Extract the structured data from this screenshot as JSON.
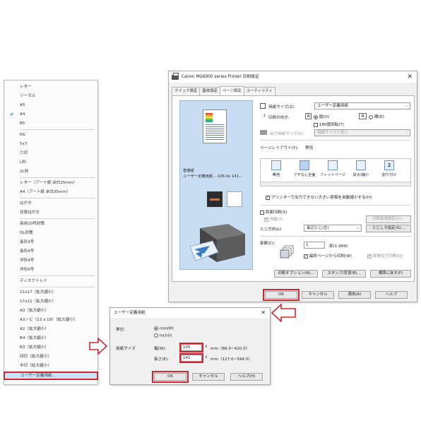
{
  "paper_list": {
    "items": [
      {
        "label": "レター",
        "checked": false
      },
      {
        "label": "リーガル",
        "checked": false
      },
      {
        "label": "A5",
        "checked": false
      },
      {
        "label": "A4",
        "checked": true
      },
      {
        "label": "B5",
        "checked": false
      },
      {
        "label": "KG",
        "checked": false
      },
      {
        "label": "5x7",
        "checked": false
      },
      {
        "label": "六切",
        "checked": false
      },
      {
        "label": "L判",
        "checked": false
      },
      {
        "label": "2L判",
        "checked": false
      },
      {
        "label": "レター（アート紙 余白35mm）",
        "checked": false
      },
      {
        "label": "A4（アート紙 余白35mm）",
        "checked": false
      },
      {
        "label": "はがき",
        "checked": false
      },
      {
        "label": "往復はがき",
        "checked": false
      },
      {
        "label": "商用10号封筒",
        "checked": false
      },
      {
        "label": "DL封筒",
        "checked": false
      },
      {
        "label": "長形3号",
        "checked": false
      },
      {
        "label": "長形4号",
        "checked": false
      },
      {
        "label": "洋形4号",
        "checked": false
      },
      {
        "label": "洋形6号",
        "checked": false
      },
      {
        "label": "ディスクトレイ",
        "checked": false
      },
      {
        "label": "11x17（拡大縮小）",
        "checked": false
      },
      {
        "label": "17x22（拡大縮小）",
        "checked": false
      },
      {
        "label": "A3（拡大縮小）",
        "checked": false
      },
      {
        "label": "A3ノビ（13 x 19）（拡大縮小）",
        "checked": false
      },
      {
        "label": "A2（拡大縮小）",
        "checked": false
      },
      {
        "label": "B4（拡大縮小）",
        "checked": false
      },
      {
        "label": "B3（拡大縮小）",
        "checked": false
      },
      {
        "label": "四切（拡大縮小）",
        "checked": false
      },
      {
        "label": "半切（拡大縮小）",
        "checked": false
      }
    ],
    "selected_item": "ユーザー定義用紙..."
  },
  "print_dialog": {
    "title": "Canon MG6900 series Printer 印刷設定",
    "close_glyph": "✕",
    "tabs": [
      {
        "label": "クイック設定",
        "active": false
      },
      {
        "label": "基本設定",
        "active": false
      },
      {
        "label": "ページ設定",
        "active": true
      },
      {
        "label": "ユーティリティ",
        "active": false
      }
    ],
    "preview": {
      "media_line1": "普通紙",
      "media_line2": "ユーザー定義用紙... 105.0x 141..."
    },
    "paper_size_label": "用紙サイズ(Z):",
    "paper_size_value": "ユーザー定義用紙",
    "orientation_label": "印刷の向き:",
    "orientation_portrait": "縦(O)",
    "orientation_landscape": "横(D)",
    "orientation_selected": "portrait",
    "rotate180_label": "180度回転(T)",
    "output_size_label": "出力用紙サイズ(E):",
    "output_size_value": "用紙サイズと同じ",
    "layout_label": "ページレイアウト(Y):",
    "layout_value": "等倍",
    "layouts": [
      {
        "label": "等倍"
      },
      {
        "label": "フチなし全面"
      },
      {
        "label": "フィットページ"
      },
      {
        "label": "拡大/縮小"
      },
      {
        "label": "割り付け"
      }
    ],
    "shrink_label": "プリンターで出力できない大きい原稿を自動縮小する(H)",
    "shrink_checked": true,
    "duplex_label": "両面印刷(X)",
    "duplex_checked": false,
    "auto_label": "自動(Y)",
    "duplex_settings_button": "印刷領域設定(U)...",
    "binding_label": "とじ方向(L):",
    "binding_value": "長辺とじ(左)",
    "binding_margin_button": "とじしろ指定(G)...",
    "copies_label": "部数(C):",
    "copies_value": "1",
    "copies_range": "部(1-999)",
    "last_page_first_label": "最終ページから印刷(W)",
    "last_page_first_checked": true,
    "collate_label": "部単位で印刷(O)",
    "collate_checked": true,
    "print_options_button": "印刷オプション(N)...",
    "stamp_button": "スタンプ/背景(B)...",
    "defaults_button": "標準に戻す(F)",
    "ok_button": "OK",
    "cancel_button": "キャンセル",
    "apply_button": "適用(A)",
    "help_button": "ヘルプ"
  },
  "user_dialog": {
    "title": "ユーザー定義用紙",
    "close_glyph": "✕",
    "unit_label": "単位:",
    "unit_mm": "mm(M)",
    "unit_inch": "inch(I)",
    "unit_selected": "mm",
    "paper_size_label": "用紙サイズ",
    "width_label": "幅(W):",
    "width_value": "105",
    "width_range": "mm（89.0~420.0）",
    "height_label": "長さ(E):",
    "height_value": "141",
    "height_range": "mm（127.0~594.0）",
    "ok_button": "OK",
    "cancel_button": "キャンセル",
    "help_button": "ヘルプ(H)"
  },
  "colors": {
    "highlight_frame": "#d6252f",
    "selection_fill": "#cce4f7",
    "check_mark": "#1d66c4"
  },
  "icons": [
    "printer-icon",
    "check-icon",
    "close-icon",
    "arrow-right-icon",
    "arrow-up-icon",
    "portrait-icon",
    "landscape-icon",
    "copies-icon"
  ]
}
